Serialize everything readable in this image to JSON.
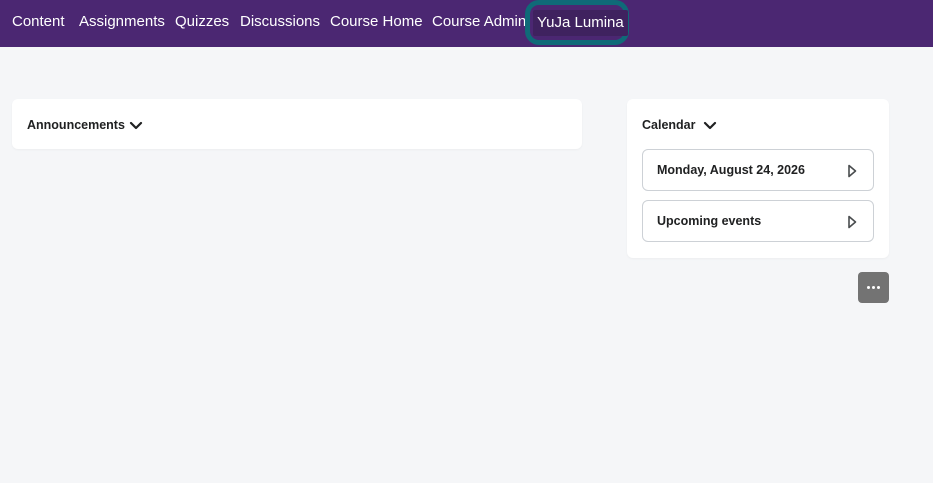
{
  "nav": {
    "items": [
      {
        "label": "Content"
      },
      {
        "label": "Assignments"
      },
      {
        "label": "Quizzes"
      },
      {
        "label": "Discussions"
      },
      {
        "label": "Course Home"
      },
      {
        "label": "Course Admin"
      },
      {
        "label": "YuJa Lumina"
      }
    ],
    "highlight_color": "#0f6a78",
    "bar_color": "#4b2772"
  },
  "announcements": {
    "title": "Announcements",
    "icon": "chevron-down-icon"
  },
  "calendar": {
    "title": "Calendar",
    "icon": "chevron-down-icon",
    "rows": [
      {
        "label": "Monday, August 24, 2026",
        "icon": "triangle-right-icon"
      },
      {
        "label": "Upcoming events",
        "icon": "triangle-right-icon"
      }
    ]
  },
  "more_button": {
    "icon": "ellipsis-icon"
  }
}
